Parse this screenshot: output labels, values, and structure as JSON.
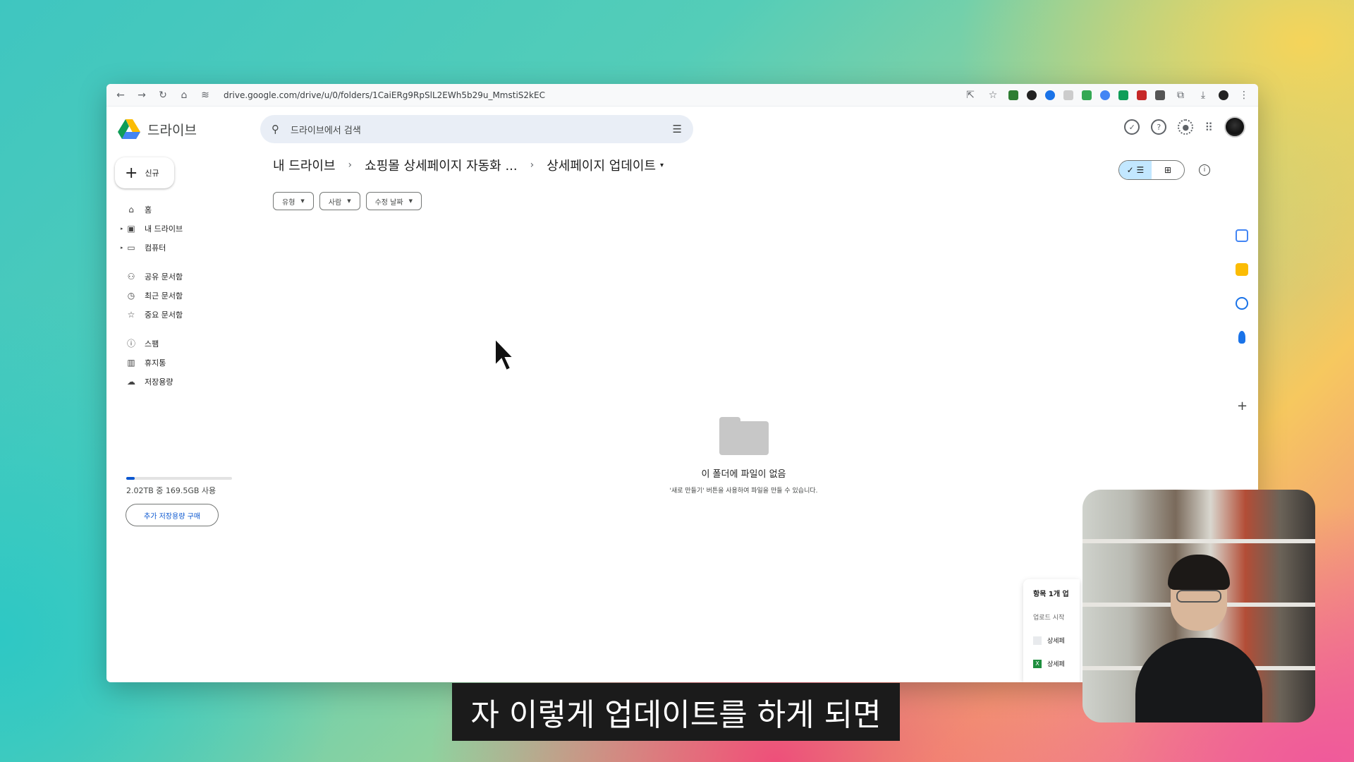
{
  "browser": {
    "url": "drive.google.com/drive/u/0/folders/1CaiERg9RpSlL2EWh5b29u_MmstiS2kEC"
  },
  "app": {
    "name": "드라이브"
  },
  "search": {
    "placeholder": "드라이브에서 검색"
  },
  "sidebar": {
    "new_label": "신규",
    "items": [
      {
        "label": "홈",
        "icon": "home-icon"
      },
      {
        "label": "내 드라이브",
        "icon": "my-drive-icon"
      },
      {
        "label": "컴퓨터",
        "icon": "computer-icon"
      },
      {
        "label": "공유 문서함",
        "icon": "shared-icon"
      },
      {
        "label": "최근 문서함",
        "icon": "clock-icon"
      },
      {
        "label": "중요 문서함",
        "icon": "star-icon"
      },
      {
        "label": "스팸",
        "icon": "spam-icon"
      },
      {
        "label": "휴지통",
        "icon": "trash-icon"
      },
      {
        "label": "저장용량",
        "icon": "cloud-icon"
      }
    ],
    "storage_text": "2.02TB 중 169.5GB 사용",
    "storage_used_fraction": 0.08,
    "buy_label": "추가 저장용량 구매"
  },
  "breadcrumb": {
    "root": "내 드라이브",
    "middle": "쇼핑몰 상세페이지 자동화 ...",
    "current": "상세페이지 업데이트"
  },
  "filters": [
    {
      "label": "유형"
    },
    {
      "label": "사람"
    },
    {
      "label": "수정 날짜"
    }
  ],
  "empty_state": {
    "title": "이 폴더에 파일이 없음",
    "subtitle": "'새로 만들기' 버튼을 사용하여 파일을 만들 수 있습니다."
  },
  "upload_panel": {
    "title": "항목 1개 업",
    "status": "업로드 시작",
    "item1": "상세페",
    "item2": "상세페"
  },
  "subtitle": "자  이렇게 업데이트를 하게 되면",
  "colors": {
    "accent": "#0b57d0",
    "search_bg": "#e9eef6",
    "toggle_on": "#c2e7ff"
  }
}
